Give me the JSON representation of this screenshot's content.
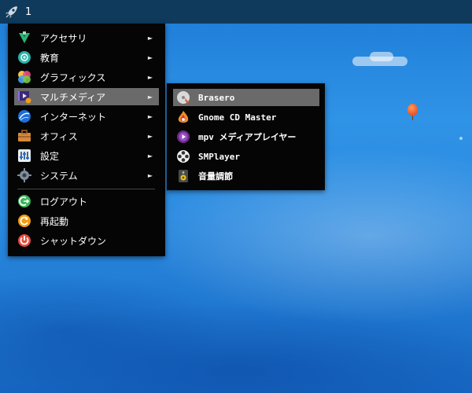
{
  "panel": {
    "workspace": "1",
    "launcher_icon": "rocket-icon"
  },
  "menu": {
    "items": [
      {
        "label": "アクセサリ",
        "icon": "accessories-icon",
        "submenu": true
      },
      {
        "label": "教育",
        "icon": "education-icon",
        "submenu": true
      },
      {
        "label": "グラフィックス",
        "icon": "graphics-icon",
        "submenu": true
      },
      {
        "label": "マルチメディア",
        "icon": "multimedia-icon",
        "submenu": true,
        "selected": true
      },
      {
        "label": "インターネット",
        "icon": "internet-icon",
        "submenu": true
      },
      {
        "label": "オフィス",
        "icon": "office-icon",
        "submenu": true
      },
      {
        "label": "設定",
        "icon": "settings-icon",
        "submenu": true
      },
      {
        "label": "システム",
        "icon": "system-icon",
        "submenu": true
      }
    ],
    "actions": [
      {
        "label": "ログアウト",
        "icon": "logout-icon"
      },
      {
        "label": "再起動",
        "icon": "restart-icon"
      },
      {
        "label": "シャットダウン",
        "icon": "shutdown-icon"
      }
    ],
    "arrow": "►"
  },
  "submenu": {
    "items": [
      {
        "label": "Brasero",
        "icon": "brasero-icon",
        "selected": true
      },
      {
        "label": "Gnome CD Master",
        "icon": "gnome-cd-master-icon"
      },
      {
        "label": "mpv メディアプレイヤー",
        "icon": "mpv-icon"
      },
      {
        "label": "SMPlayer",
        "icon": "smplayer-icon"
      },
      {
        "label": "音量調節",
        "icon": "volume-control-icon"
      }
    ]
  },
  "colors": {
    "panel": "#0f3a5c",
    "menu_bg": "#050505",
    "highlight": "#6a6a6a"
  }
}
